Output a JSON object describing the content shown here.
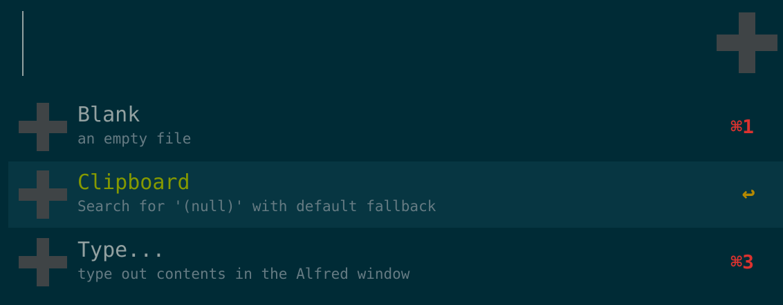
{
  "search": {
    "value": "",
    "placeholder": ""
  },
  "header": {
    "icon": "plus-icon"
  },
  "results": [
    {
      "title": "Blank",
      "subtitle": "an empty file",
      "shortcut": "⌘1",
      "icon": "plus-icon",
      "selected": false
    },
    {
      "title": "Clipboard",
      "subtitle": "Search for '(null)' with default fallback",
      "shortcut": "↩",
      "icon": "plus-icon",
      "selected": true
    },
    {
      "title": "Type...",
      "subtitle": "type out contents in the Alfred window",
      "shortcut": "⌘3",
      "icon": "plus-icon",
      "selected": false
    }
  ],
  "colors": {
    "background": "#002b36",
    "selected_background": "#073642",
    "title": "#93a1a1",
    "selected_title": "#859900",
    "subtitle": "#657b83",
    "shortcut": "#dc322f",
    "selected_shortcut": "#b58900",
    "icon": "#3f4446"
  }
}
